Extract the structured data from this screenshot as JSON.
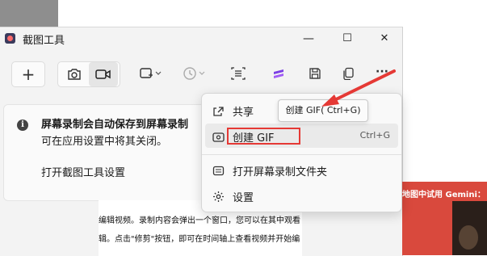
{
  "window": {
    "title": "截图工具",
    "controls": {
      "minimize": "—",
      "maximize": "☐",
      "close": "✕"
    }
  },
  "toolbar": {
    "new_label": "+",
    "more_label": "···",
    "icons": [
      "camera-icon",
      "video-icon",
      "rect-select-icon",
      "timer-icon",
      "text-actions-icon",
      "clipchamp-icon",
      "save-icon",
      "copy-icon",
      "more-icon"
    ]
  },
  "banner": {
    "title": "屏幕录制会自动保存到屏幕录制",
    "body": "可在应用设置中将其关闭。",
    "link": "打开截图工具设置"
  },
  "menu": {
    "share": "共享",
    "create_gif": "创建 GIF",
    "create_gif_shortcut": "Ctrl+G",
    "open_folder": "打开屏幕录制文件夹",
    "settings": "设置"
  },
  "tooltip": {
    "text": "创建 GIF( Ctrl+G)"
  },
  "document": {
    "line1": "编辑视频。录制内容会弹出一个窗口，您可以在其中观看",
    "line2": "辑。点击\"修剪\"按钮，即可在时间轴上查看视频并开始编"
  },
  "side_image": {
    "caption": "地图中试用 Gemini："
  },
  "colors": {
    "accent": "#5b5fc7",
    "highlight_red": "#e53935"
  }
}
